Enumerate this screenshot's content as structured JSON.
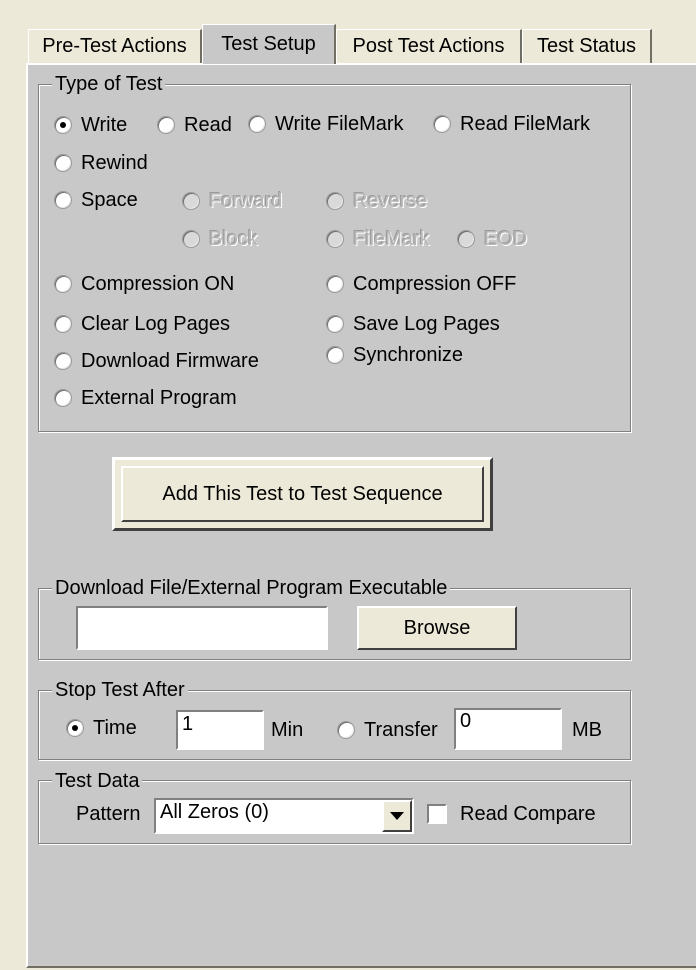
{
  "tabs": [
    {
      "label": "Pre-Test Actions"
    },
    {
      "label": "Test Setup"
    },
    {
      "label": "Post Test Actions"
    },
    {
      "label": "Test Status"
    }
  ],
  "active_tab": "Test Setup",
  "type_of_test": {
    "legend": "Type of Test",
    "options": {
      "write": "Write",
      "read": "Read",
      "write_filemark": "Write FileMark",
      "read_filemark": "Read FileMark",
      "rewind": "Rewind",
      "space": "Space",
      "forward": "Forward",
      "reverse": "Reverse",
      "block": "Block",
      "filemark": "FileMark",
      "eod": "EOD",
      "compression_on": "Compression ON",
      "compression_off": "Compression OFF",
      "clear_log_pages": "Clear Log Pages",
      "save_log_pages": "Save Log Pages",
      "download_firmware": "Download Firmware",
      "synchronize": "Synchronize",
      "external_program": "External Program"
    },
    "selected": "Write"
  },
  "add_test_button": "Add This Test to Test Sequence",
  "download_group": {
    "legend": "Download File/External Program Executable",
    "path_value": "",
    "browse_label": "Browse"
  },
  "stop_test": {
    "legend": "Stop Test After",
    "time_label": "Time",
    "time_value": "1",
    "time_unit": "Min",
    "transfer_label": "Transfer",
    "transfer_value": "0",
    "transfer_unit": "MB",
    "selected": "Time"
  },
  "test_data": {
    "legend": "Test Data",
    "pattern_label": "Pattern",
    "pattern_value": "All Zeros (0)",
    "read_compare_label": "Read Compare",
    "read_compare_checked": false
  }
}
